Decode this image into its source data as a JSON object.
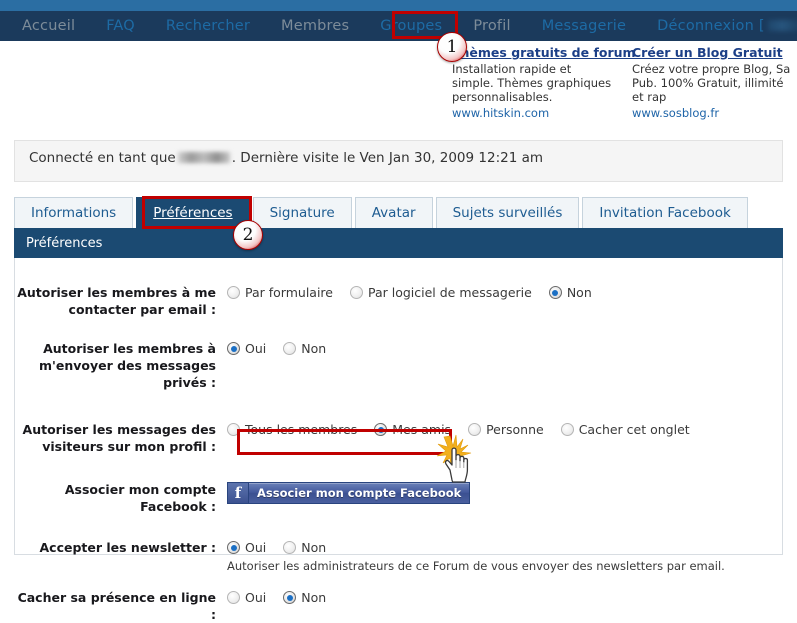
{
  "nav": {
    "items": [
      {
        "label": "Accueil",
        "style": "gray"
      },
      {
        "label": "FAQ",
        "style": "blue"
      },
      {
        "label": "Rechercher",
        "style": "blue"
      },
      {
        "label": "Membres",
        "style": "gray"
      },
      {
        "label": "Groupes",
        "style": "blue"
      },
      {
        "label": "Profil",
        "style": "gray"
      },
      {
        "label": "Messagerie",
        "style": "blue"
      },
      {
        "label": "Déconnexion",
        "style": "blue"
      }
    ],
    "logout_bracket_open": "[",
    "logout_bracket_close": "]",
    "logout_username": "(masqué)"
  },
  "ads": [
    {
      "title": "Thèmes gratuits de forum",
      "body": "Installation rapide et simple. Thèmes graphiques personnalisables.",
      "url": "www.hitskin.com"
    },
    {
      "title": "Créer un Blog Gratuit",
      "body": "Créez votre propre Blog, Sa Pub. 100% Gratuit, illimité et rap",
      "url": "www.sosblog.fr"
    }
  ],
  "connected": {
    "prefix": "Connecté en tant que",
    "username": "(masqué)",
    "suffix": ". Dernière visite le Ven Jan 30, 2009 12:21 am"
  },
  "tabs": [
    {
      "label": "Informations",
      "active": false
    },
    {
      "label": "Préférences",
      "active": true
    },
    {
      "label": "Signature",
      "active": false
    },
    {
      "label": "Avatar",
      "active": false
    },
    {
      "label": "Sujets surveillés",
      "active": false
    },
    {
      "label": "Invitation Facebook",
      "active": false
    }
  ],
  "section": {
    "title": "Préférences"
  },
  "form": {
    "rows": [
      {
        "label": "Autoriser les membres à me contacter par email :",
        "type": "radios",
        "options": [
          {
            "label": "Par formulaire",
            "checked": false
          },
          {
            "label": "Par logiciel de messagerie",
            "checked": false
          },
          {
            "label": "Non",
            "checked": true
          }
        ]
      },
      {
        "label": "Autoriser les membres à m'envoyer des messages privés :",
        "type": "radios",
        "options": [
          {
            "label": "Oui",
            "checked": true
          },
          {
            "label": "Non",
            "checked": false
          }
        ]
      },
      {
        "label": "Autoriser les messages des visiteurs sur mon profil :",
        "type": "radios",
        "options": [
          {
            "label": "Tous les membres",
            "checked": false
          },
          {
            "label": "Mes amis",
            "checked": true
          },
          {
            "label": "Personne",
            "checked": false
          },
          {
            "label": "Cacher cet onglet",
            "checked": false
          }
        ]
      },
      {
        "label": "Associer mon compte Facebook :",
        "type": "fb-button",
        "button_label": "Associer mon compte Facebook",
        "button_logo": "f"
      },
      {
        "label": "Accepter les newsletter :",
        "type": "radios",
        "options": [
          {
            "label": "Oui",
            "checked": true
          },
          {
            "label": "Non",
            "checked": false
          }
        ],
        "help": "Autoriser les administrateurs de ce Forum de vous envoyer des newsletters par email."
      },
      {
        "label": "Cacher sa présence en ligne :",
        "type": "radios",
        "options": [
          {
            "label": "Oui",
            "checked": false
          },
          {
            "label": "Non",
            "checked": true
          }
        ]
      }
    ]
  },
  "annotations": {
    "markers": [
      {
        "number": "1"
      },
      {
        "number": "2"
      }
    ],
    "highlight_color": "#c00000",
    "marker_ring_color": "#d02020"
  },
  "colors": {
    "top_strip": "#2b6ea3",
    "navbar": "#1b3a5c",
    "section_header": "#1b4a72",
    "tab_active_bg": "#1b4a72",
    "link_blue": "#1e64a8",
    "ad_title_blue": "#1c3f87",
    "radio_dot": "#1b6fc4",
    "facebook_blue": "#3b5091"
  }
}
